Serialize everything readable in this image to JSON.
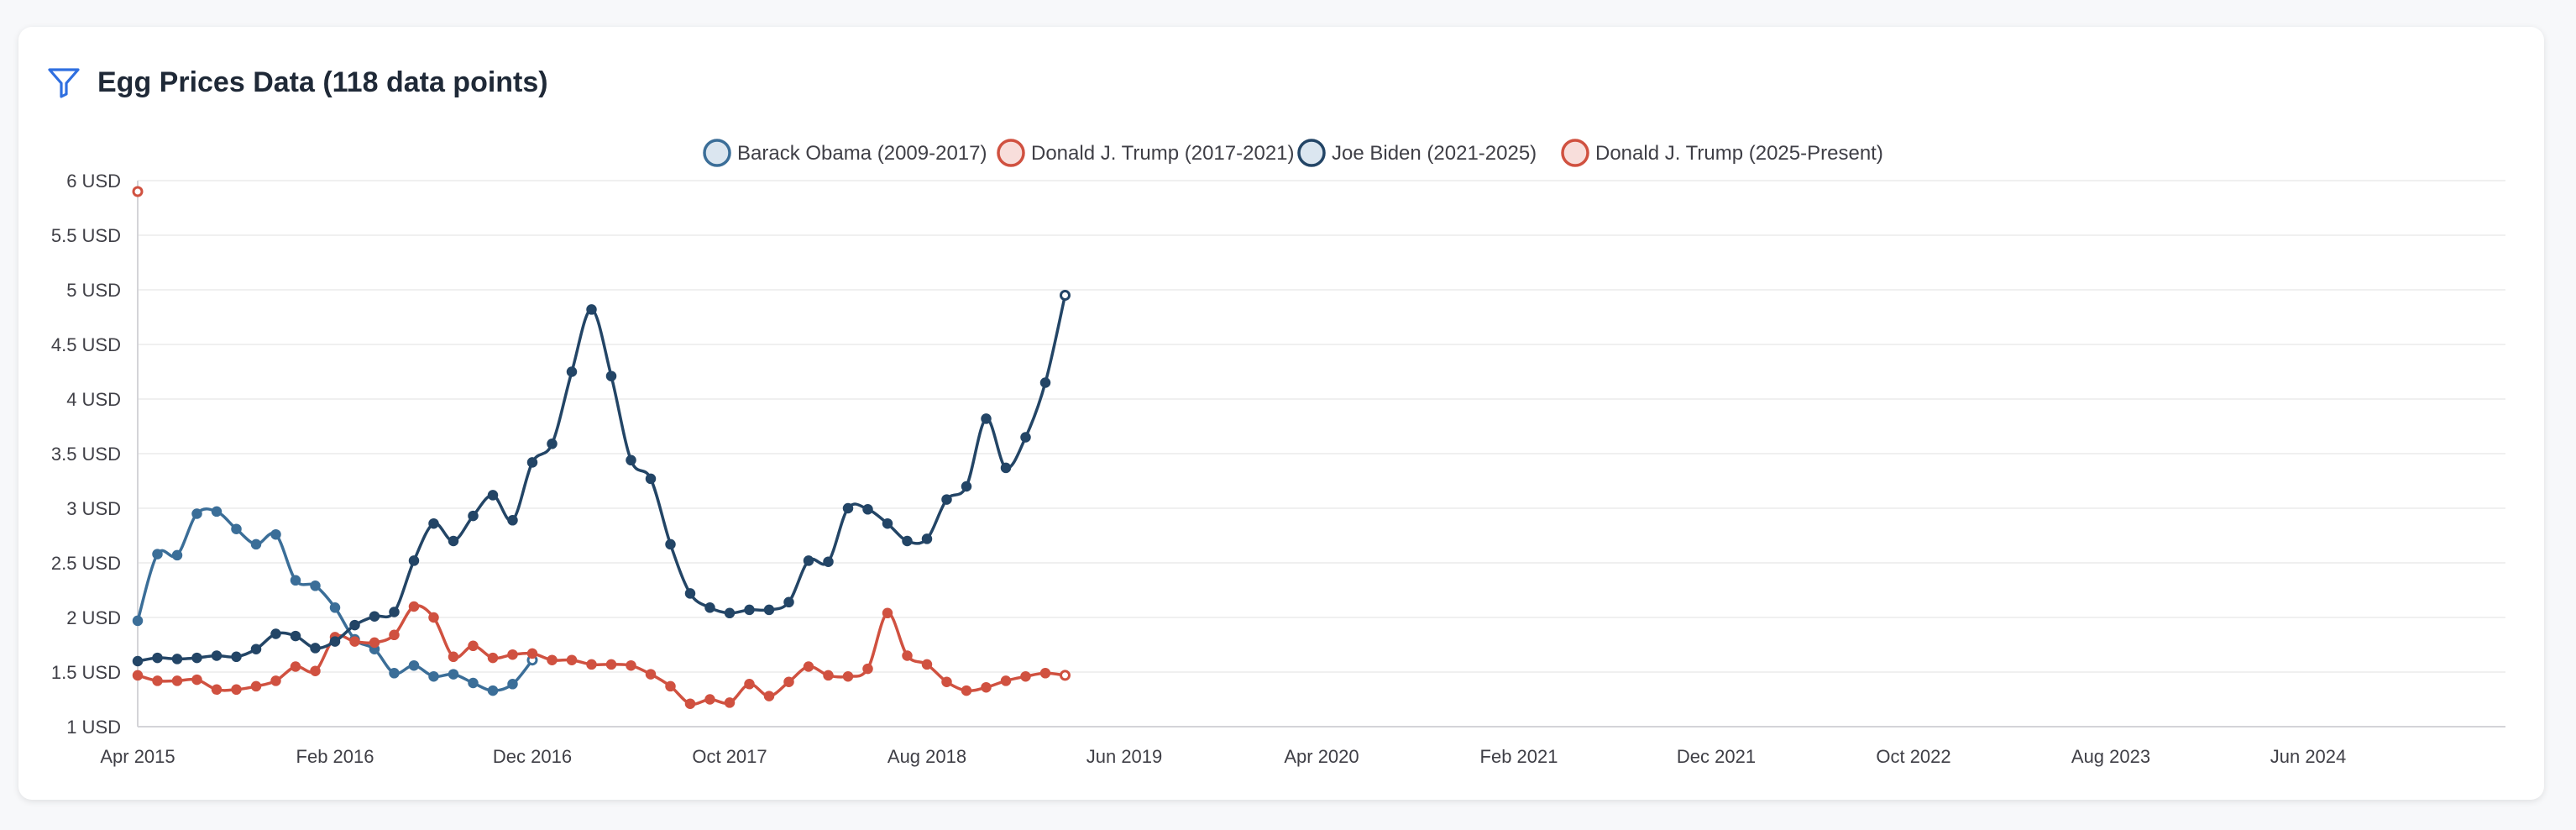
{
  "header": {
    "title": "Egg Prices Data (118 data points)",
    "icon": "filter-icon"
  },
  "colors": {
    "obama": "#3b6e98",
    "trump1": "#d05140",
    "biden": "#234566",
    "trump2": "#d05140"
  },
  "chart_data": {
    "type": "line",
    "title": "Egg Prices Data (118 data points)",
    "xlabel": "",
    "ylabel": "",
    "ylim": [
      1,
      6
    ],
    "xlim": [
      "2015-04-01",
      "2025-04-01"
    ],
    "y_ticks": [
      "1 USD",
      "1.5 USD",
      "2 USD",
      "2.5 USD",
      "3 USD",
      "3.5 USD",
      "4 USD",
      "4.5 USD",
      "5 USD",
      "5.5 USD",
      "6 USD"
    ],
    "x_ticks": [
      "Apr 2015",
      "Feb 2016",
      "Dec 2016",
      "Oct 2017",
      "Aug 2018",
      "Jun 2019",
      "Apr 2020",
      "Feb 2021",
      "Dec 2021",
      "Oct 2022",
      "Aug 2023",
      "Jun 2024"
    ],
    "grid": "horizontal",
    "legend": "top-center",
    "series": [
      {
        "name": "Barack Obama (2009-2017)",
        "color": "#3b6e98",
        "fill": "#dbe6f0",
        "values": [
          1.97,
          2.58,
          2.57,
          2.95,
          2.97,
          2.81,
          2.67,
          2.76,
          2.34,
          2.29,
          2.09,
          1.8,
          1.71,
          1.49,
          1.56,
          1.46,
          1.48,
          1.4,
          1.33,
          1.39,
          1.61
        ]
      },
      {
        "name": "Donald J. Trump (2017-2021)",
        "color": "#d05140",
        "fill": "#f8dedb",
        "values": [
          1.47,
          1.42,
          1.42,
          1.43,
          1.34,
          1.34,
          1.37,
          1.42,
          1.55,
          1.51,
          1.82,
          1.78,
          1.77,
          1.84,
          2.1,
          2.0,
          1.64,
          1.74,
          1.63,
          1.66,
          1.67,
          1.61,
          1.61,
          1.57,
          1.57,
          1.56,
          1.48,
          1.37,
          1.21,
          1.25,
          1.22,
          1.39,
          1.28,
          1.41,
          1.55,
          1.47,
          1.46,
          1.53,
          2.04,
          1.65,
          1.57,
          1.41,
          1.33,
          1.36,
          1.42,
          1.46,
          1.49,
          1.47
        ]
      },
      {
        "name": "Joe Biden (2021-2025)",
        "color": "#234566",
        "fill": "#dbe6f0",
        "values": [
          1.6,
          1.63,
          1.62,
          1.63,
          1.65,
          1.64,
          1.71,
          1.85,
          1.83,
          1.72,
          1.78,
          1.93,
          2.01,
          2.05,
          2.52,
          2.86,
          2.7,
          2.93,
          3.12,
          2.89,
          3.42,
          3.59,
          4.25,
          4.82,
          4.21,
          3.44,
          3.27,
          2.67,
          2.22,
          2.09,
          2.04,
          2.07,
          2.07,
          2.14,
          2.52,
          2.51,
          3.0,
          2.99,
          2.86,
          2.7,
          2.72,
          3.08,
          3.2,
          3.82,
          3.37,
          3.65,
          4.15,
          4.95
        ]
      },
      {
        "name": "Donald J. Trump (2025-Present)",
        "color": "#d05140",
        "fill": "#f8dedb",
        "values": [
          5.9
        ]
      }
    ]
  }
}
